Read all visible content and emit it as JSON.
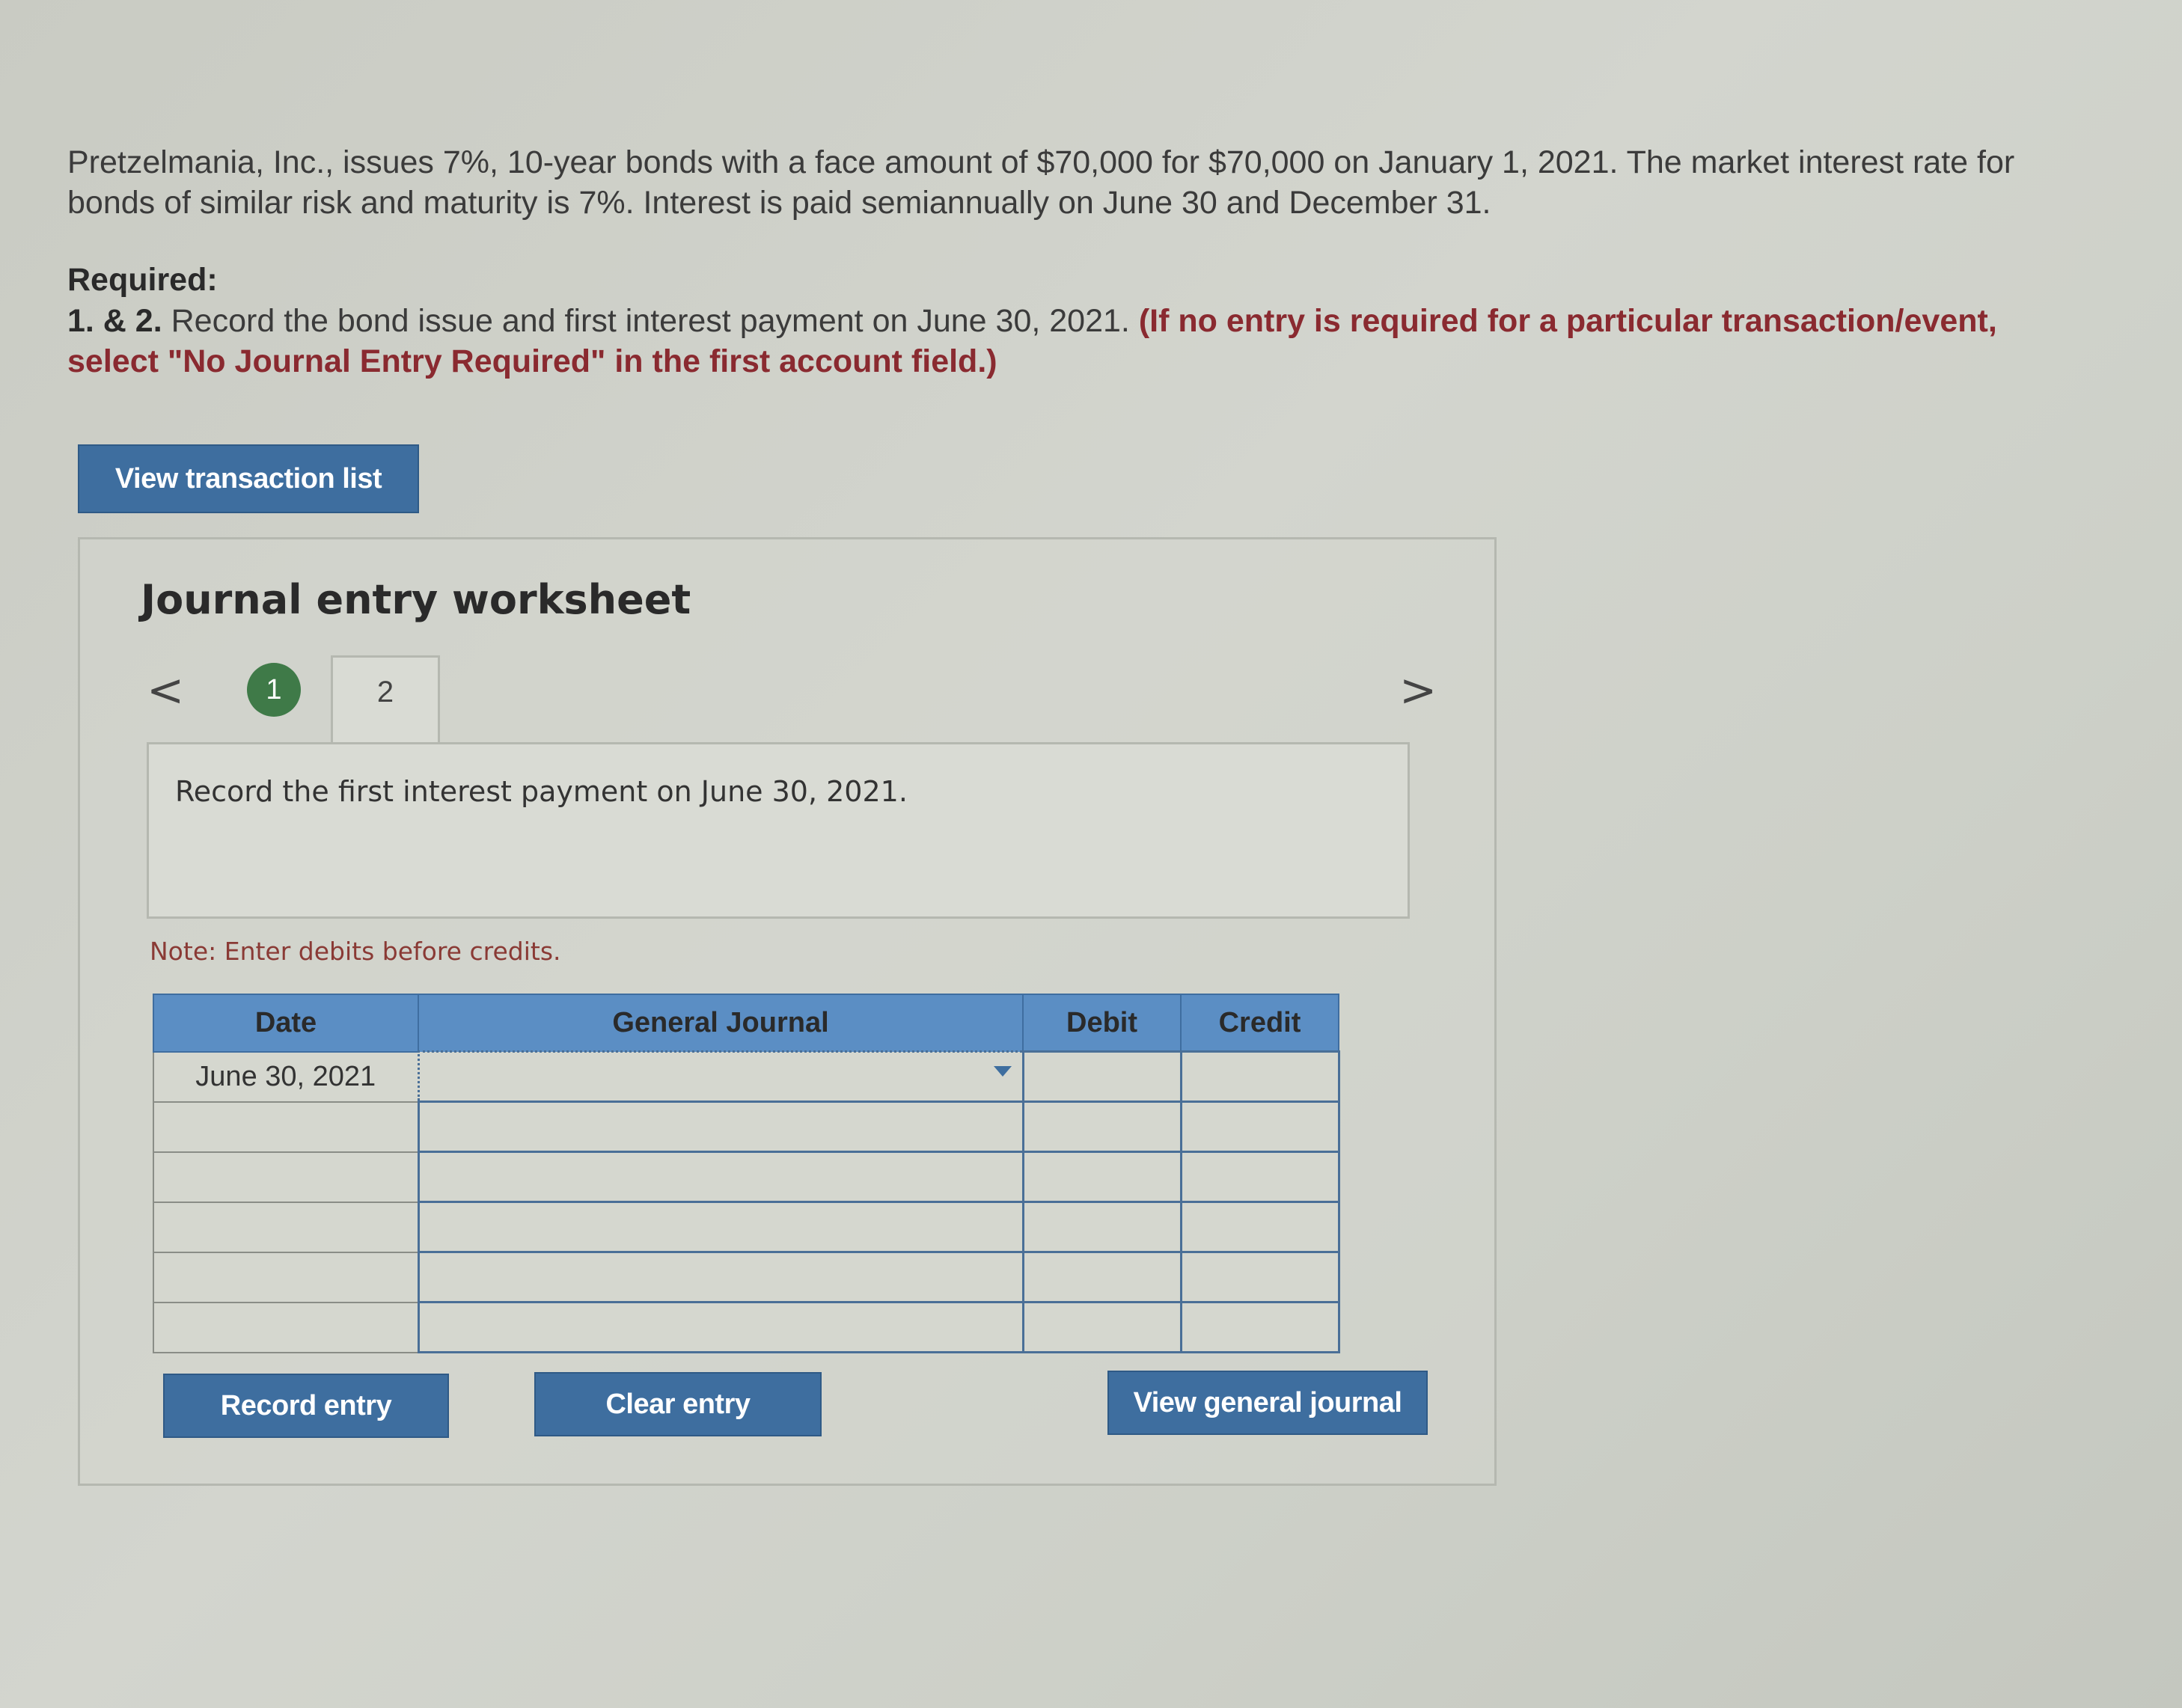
{
  "problem": {
    "text": "Pretzelmania, Inc., issues 7%, 10-year bonds with a face amount of $70,000 for $70,000 on January 1, 2021. The market interest rate for bonds of similar risk and maturity is 7%. Interest is paid semiannually on June 30 and December 31."
  },
  "required": {
    "heading": "Required:",
    "number": "1. & 2.",
    "text": "Record the bond issue and first interest payment on June 30, 2021.",
    "instruction": "(If no entry is required for a particular transaction/event, select \"No Journal Entry Required\" in the first account field.)"
  },
  "buttons": {
    "view_transaction_list": "View transaction list",
    "record_entry": "Record entry",
    "clear_entry": "Clear entry",
    "view_general_journal": "View general journal"
  },
  "worksheet": {
    "title": "Journal entry worksheet",
    "prev_glyph": "<",
    "next_glyph": ">",
    "steps": [
      {
        "label": "1",
        "completed": true
      },
      {
        "label": "2",
        "active": true
      }
    ],
    "instruction": "Record the first interest payment on June 30, 2021.",
    "note": "Note: Enter debits before credits."
  },
  "journal": {
    "headers": [
      "Date",
      "General Journal",
      "Debit",
      "Credit"
    ],
    "rows": [
      {
        "date": "June 30, 2021",
        "account": "",
        "debit": "",
        "credit": ""
      },
      {
        "date": "",
        "account": "",
        "debit": "",
        "credit": ""
      },
      {
        "date": "",
        "account": "",
        "debit": "",
        "credit": ""
      },
      {
        "date": "",
        "account": "",
        "debit": "",
        "credit": ""
      },
      {
        "date": "",
        "account": "",
        "debit": "",
        "credit": ""
      },
      {
        "date": "",
        "account": "",
        "debit": "",
        "credit": ""
      }
    ]
  },
  "colors": {
    "button_bg": "#3e6e9f",
    "table_header": "#5b8ec4",
    "step_complete": "#3f7a48",
    "instruction_red": "#8a2a30"
  }
}
